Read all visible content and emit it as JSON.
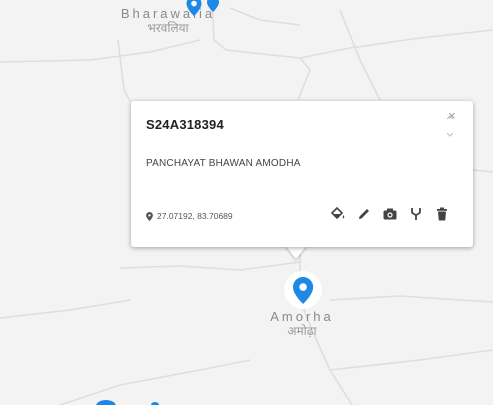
{
  "map": {
    "places": [
      {
        "name_en": "Bharawalia",
        "name_hi": "भरवलिया"
      },
      {
        "name_en": "Amorha",
        "name_hi": "अमोढ़ा"
      }
    ],
    "marker_color": "#1e88e5",
    "road_color": "#dcdcdc"
  },
  "popup": {
    "title": "S24A318394",
    "close_symbol": "×",
    "address": "PANCHAYAT BHAWAN AMODHA",
    "coords": "27.07192, 83.70689",
    "actions": [
      {
        "icon": "paint-bucket-icon"
      },
      {
        "icon": "pencil-icon"
      },
      {
        "icon": "camera-icon"
      },
      {
        "icon": "fork-icon"
      },
      {
        "icon": "trash-icon"
      }
    ]
  }
}
